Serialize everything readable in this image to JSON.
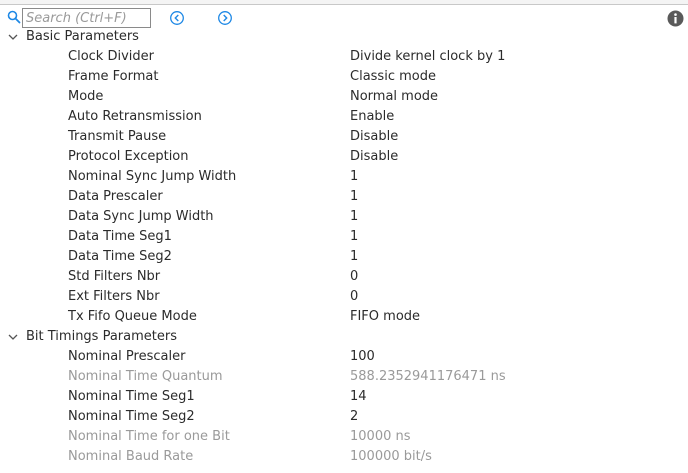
{
  "toolbar": {
    "search_placeholder": "Search (Ctrl+F)"
  },
  "groups": [
    {
      "title": "Basic Parameters",
      "rows": [
        {
          "label": "Clock Divider",
          "value": "Divide kernel clock by 1"
        },
        {
          "label": "Frame Format",
          "value": "Classic mode"
        },
        {
          "label": "Mode",
          "value": "Normal mode"
        },
        {
          "label": "Auto Retransmission",
          "value": "Enable"
        },
        {
          "label": "Transmit Pause",
          "value": "Disable"
        },
        {
          "label": "Protocol Exception",
          "value": "Disable"
        },
        {
          "label": "Nominal Sync Jump Width",
          "value": "1"
        },
        {
          "label": "Data Prescaler",
          "value": "1"
        },
        {
          "label": "Data Sync Jump Width",
          "value": "1"
        },
        {
          "label": "Data Time Seg1",
          "value": "1"
        },
        {
          "label": "Data Time Seg2",
          "value": "1"
        },
        {
          "label": "Std Filters Nbr",
          "value": "0"
        },
        {
          "label": "Ext Filters Nbr",
          "value": "0"
        },
        {
          "label": "Tx Fifo Queue Mode",
          "value": "FIFO mode"
        }
      ]
    },
    {
      "title": "Bit Timings Parameters",
      "rows": [
        {
          "label": "Nominal Prescaler",
          "value": "100"
        },
        {
          "label": "Nominal Time Quantum",
          "value": "588.2352941176471 ns"
        },
        {
          "label": "Nominal Time Seg1",
          "value": "14"
        },
        {
          "label": "Nominal Time Seg2",
          "value": "2"
        },
        {
          "label": "Nominal Time for one Bit",
          "value": "10000 ns"
        },
        {
          "label": "Nominal Baud Rate",
          "value": "100000 bit/s"
        }
      ]
    }
  ],
  "colors": {
    "accent": "#1e88e5",
    "text": "#2b2b2b",
    "readonly_text": "#9a9a9a"
  }
}
